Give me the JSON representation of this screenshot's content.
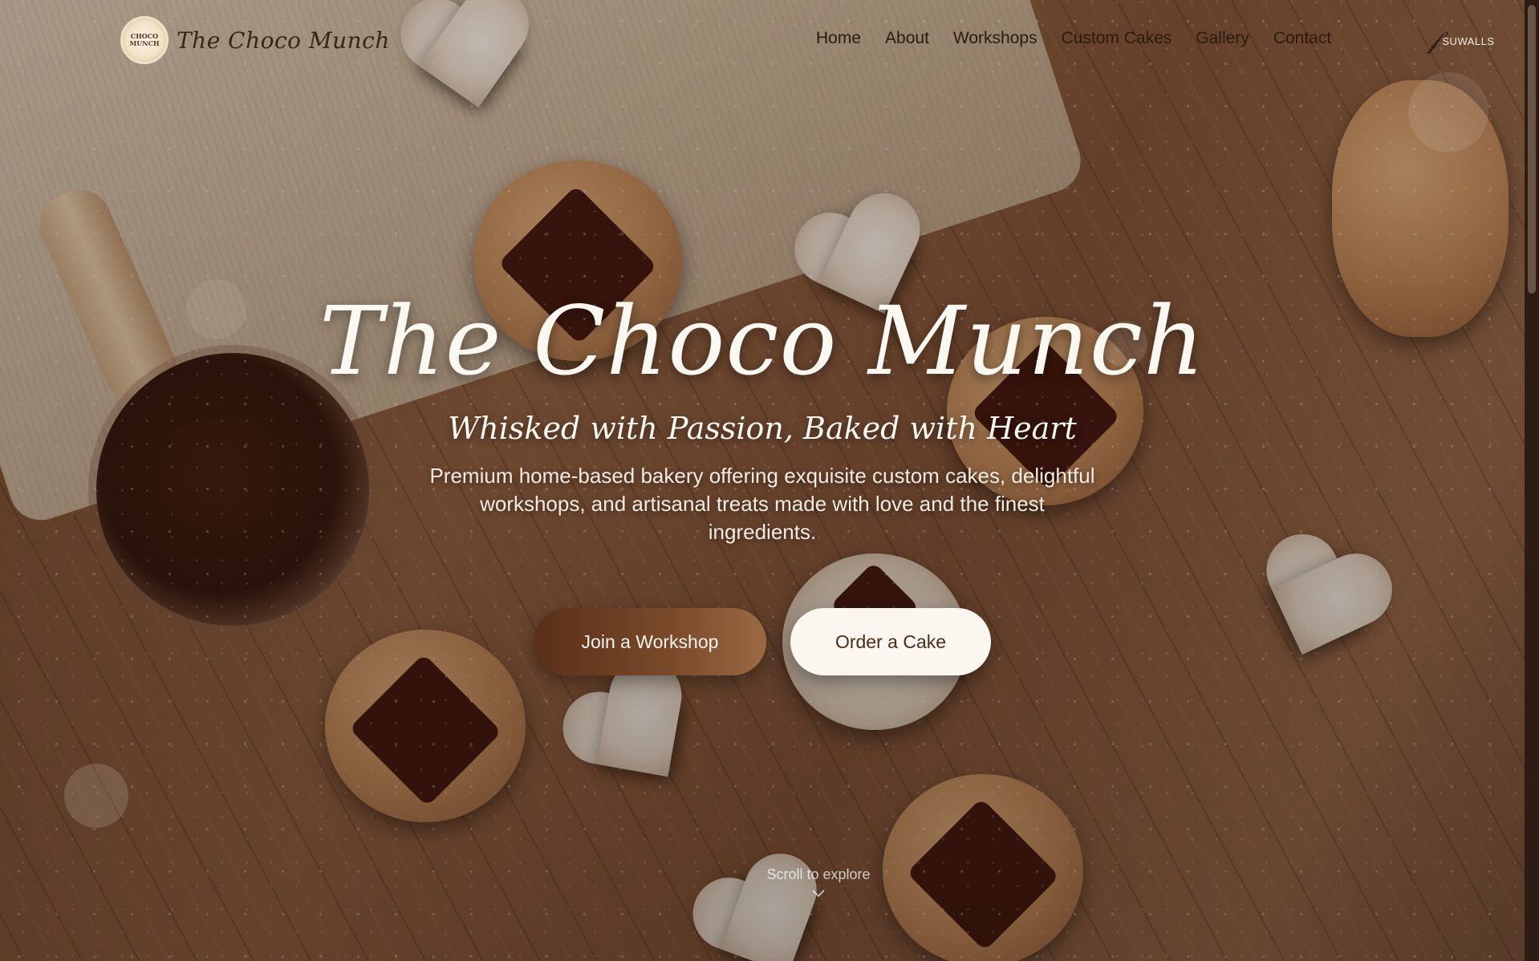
{
  "brand": {
    "logo_text": "CHOCO MUNCH",
    "name": "The Choco Munch"
  },
  "nav": {
    "items": [
      {
        "label": "Home"
      },
      {
        "label": "About"
      },
      {
        "label": "Workshops"
      },
      {
        "label": "Custom Cakes"
      },
      {
        "label": "Gallery"
      },
      {
        "label": "Contact"
      }
    ]
  },
  "signature": {
    "text": "SUWALLS"
  },
  "hero": {
    "title": "The Choco Munch",
    "tagline": "Whisked with Passion, Baked with Heart",
    "description": "Premium home-based bakery offering exquisite custom cakes, delightful workshops, and artisanal treats made with love and the finest ingredients.",
    "primary_cta": "Join a Workshop",
    "secondary_cta": "Order a Cake",
    "scroll_hint": "Scroll to explore"
  },
  "colors": {
    "primary_button": "#6a3d22",
    "secondary_button": "#fbf6ef",
    "title_text": "#fbf7f1"
  },
  "icons": {
    "scroll": "chevron-down-icon"
  }
}
